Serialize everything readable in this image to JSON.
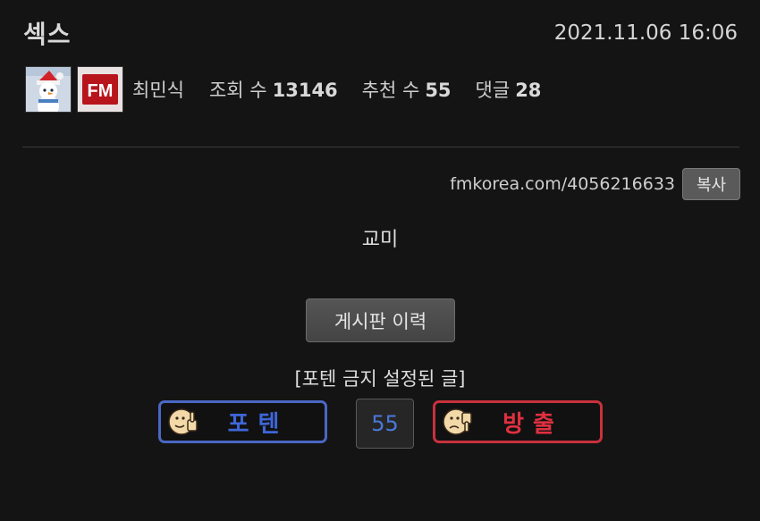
{
  "post": {
    "title": "섹스",
    "date": "2021.11.06 16:06",
    "author": "최민식",
    "stats": {
      "views_label": "조회 수",
      "views": "13146",
      "recommends_label": "추천 수",
      "recommends": "55",
      "comments_label": "댓글",
      "comments": "28"
    },
    "url": "fmkorea.com/4056216633",
    "copy_label": "복사",
    "body": "교미",
    "history_label": "게시판 이력",
    "notice": "[포텐 금지 설정된 글]"
  },
  "vote": {
    "up_label": "포텐",
    "count": "55",
    "down_label": "방출"
  },
  "colors": {
    "background": "#141414",
    "vote_up": "#4a68c4",
    "vote_down": "#c8313c"
  },
  "icons": {
    "avatar": "snowman-avatar-icon",
    "level_badge": "fm-badge-icon",
    "vote_up": "thumbs-up-face-icon",
    "vote_down": "thumbs-down-face-icon"
  }
}
